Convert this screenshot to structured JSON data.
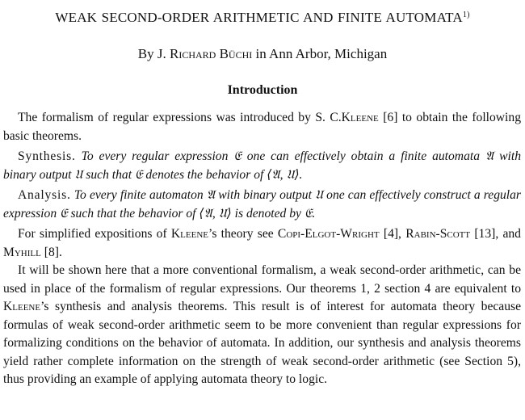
{
  "title": {
    "text": "WEAK SECOND-ORDER ARITHMETIC AND FINITE AUTOMATA",
    "footnote": "1)"
  },
  "byline": {
    "prefix": "By J.",
    "author": "Richard Büchi",
    "suffix": "in Ann Arbor, Michigan"
  },
  "section_heading": "Introduction",
  "paragraphs": {
    "p1": {
      "t1": "The formalism of regular expressions was introduced by S. C.",
      "name": "Kleene",
      "t2": "[6] to obtain the following basic theorems."
    },
    "synthesis": {
      "label": "Synthesis.",
      "text": "To every regular expression 𝔈 one can effectively obtain a finite automata 𝔄 with binary output 𝔘 such that 𝔈 denotes the behavior of ⟨𝔄, 𝔘⟩."
    },
    "analysis": {
      "label": "Analysis.",
      "text": "To every finite automaton 𝔄 with binary output 𝔘 one can effectively construct a regular expression 𝔈 such that the behavior of ⟨𝔄, 𝔘⟩ is denoted by 𝔈."
    },
    "p4": {
      "t1": "For simplified expositions of",
      "name1": "Kleene",
      "t2": "’s theory see",
      "name2": "Copi-Elgot-Wright",
      "t3": "[4],",
      "name3": "Rabin-Scott",
      "t4": "[13], and",
      "name4": "Myhill",
      "t5": "[8]."
    },
    "p5": {
      "t1": "It will be shown here that a more conventional formalism, a weak second-order arithmetic, can be used in place of the formalism of regular expressions. Our theorems 1, 2 section 4 are equivalent to",
      "name": "Kleene",
      "t2": "’s synthesis and analysis theorems. This result is of interest for automata theory because formulas of weak second-order arithmetic seem to be more convenient than regular expressions for formalizing conditions on the behavior of automata. In addition, our synthesis and analysis theorems yield rather complete information on the strength of weak second-order arithmetic (see Section 5), thus providing an example of applying automata theory to logic."
    }
  }
}
